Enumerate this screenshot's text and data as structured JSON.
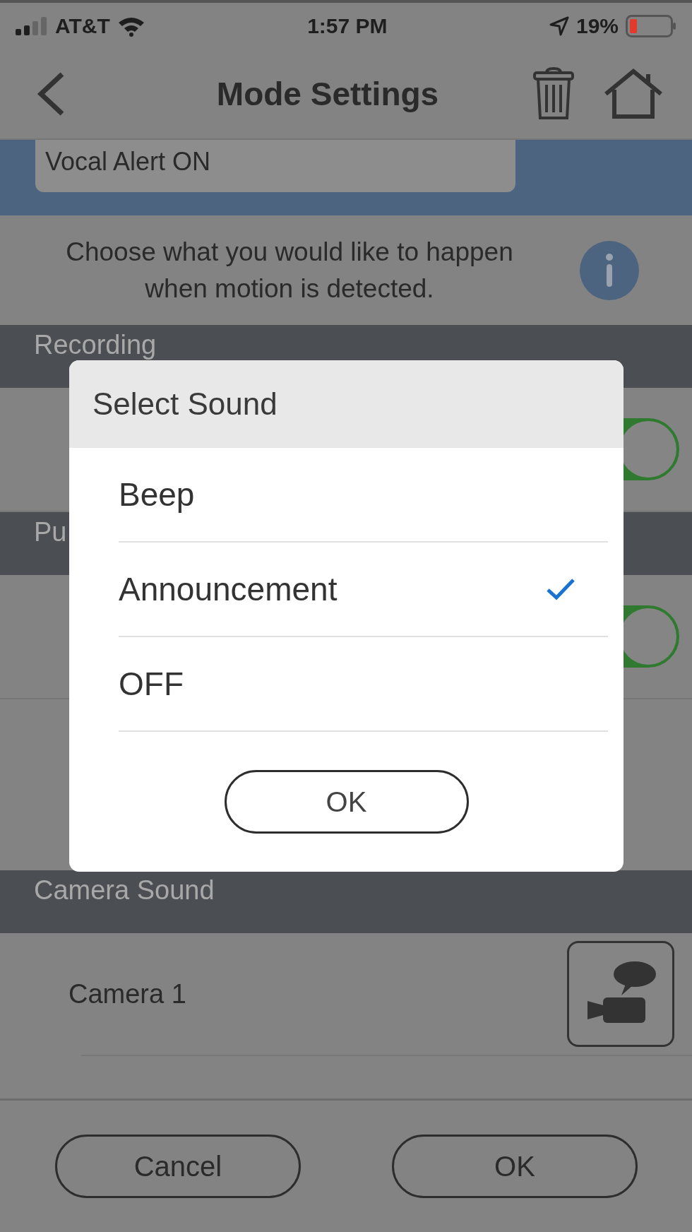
{
  "status_bar": {
    "carrier": "AT&T",
    "time": "1:57 PM",
    "battery": "19%"
  },
  "nav": {
    "title": "Mode Settings"
  },
  "vocal_alert": {
    "value": "Vocal Alert ON"
  },
  "description": "Choose what you would like to happen when motion is detected.",
  "sections": [
    {
      "title": "Recording",
      "rows": [
        {
          "kind": "toggle",
          "on": true
        }
      ]
    },
    {
      "title": "Pu",
      "rows": [
        {
          "kind": "toggle",
          "on": true
        },
        {
          "kind": "blank"
        }
      ]
    },
    {
      "title": "Camera Sound",
      "rows": [
        {
          "kind": "camera",
          "label": "Camera 1"
        }
      ]
    }
  ],
  "footer": {
    "cancel": "Cancel",
    "ok": "OK"
  },
  "dialog": {
    "title": "Select Sound",
    "options": [
      {
        "label": "Beep",
        "selected": false
      },
      {
        "label": "Announcement",
        "selected": true
      },
      {
        "label": "OFF",
        "selected": false
      }
    ],
    "ok": "OK"
  }
}
